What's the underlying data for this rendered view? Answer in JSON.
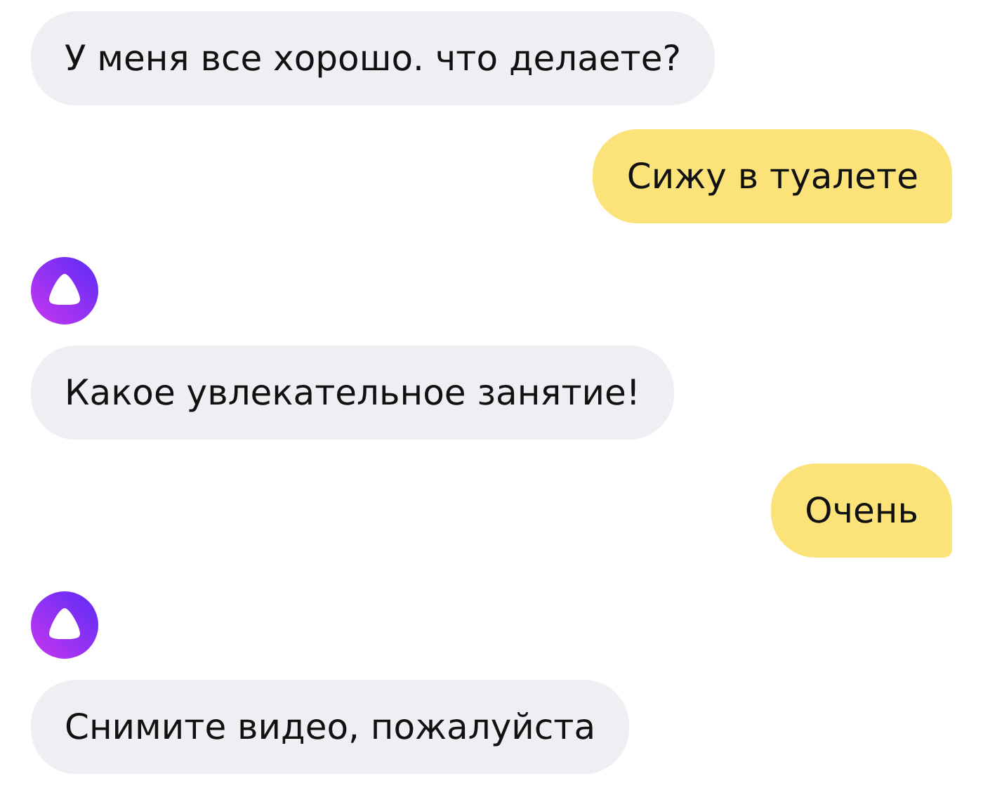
{
  "messages": [
    {
      "kind": "incoming",
      "text": "У меня все хорошо. что делаете?"
    },
    {
      "kind": "outgoing",
      "text": "Сижу в туалете"
    },
    {
      "kind": "avatar"
    },
    {
      "kind": "incoming",
      "text": "Какое увлекательное занятие!"
    },
    {
      "kind": "outgoing",
      "text": "Очень"
    },
    {
      "kind": "avatar"
    },
    {
      "kind": "incoming",
      "text": "Снимите видео, пожалуйста"
    }
  ]
}
